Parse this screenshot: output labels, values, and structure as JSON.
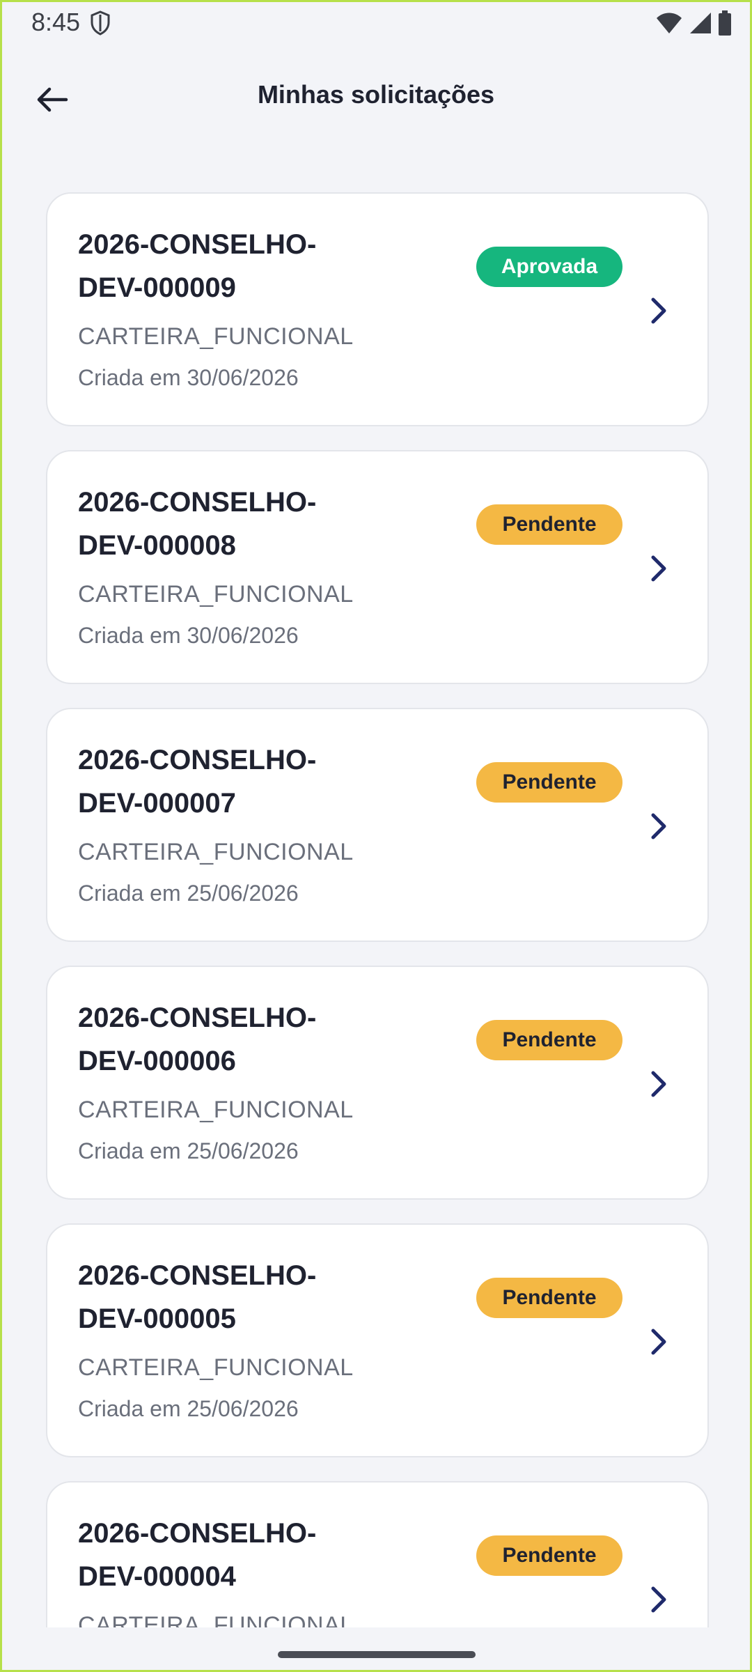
{
  "status_bar": {
    "time": "8:45"
  },
  "app_bar": {
    "title": "Minhas solicitações"
  },
  "requests": [
    {
      "id_line1": "2026-CONSELHO-",
      "id_line2": "DEV-000009",
      "type": "CARTEIRA_FUNCIONAL",
      "created": "Criada em 30/06/2026",
      "status": "Aprovada"
    },
    {
      "id_line1": "2026-CONSELHO-",
      "id_line2": "DEV-000008",
      "type": "CARTEIRA_FUNCIONAL",
      "created": "Criada em 30/06/2026",
      "status": "Pendente"
    },
    {
      "id_line1": "2026-CONSELHO-",
      "id_line2": "DEV-000007",
      "type": "CARTEIRA_FUNCIONAL",
      "created": "Criada em 25/06/2026",
      "status": "Pendente"
    },
    {
      "id_line1": "2026-CONSELHO-",
      "id_line2": "DEV-000006",
      "type": "CARTEIRA_FUNCIONAL",
      "created": "Criada em 25/06/2026",
      "status": "Pendente"
    },
    {
      "id_line1": "2026-CONSELHO-",
      "id_line2": "DEV-000005",
      "type": "CARTEIRA_FUNCIONAL",
      "created": "Criada em 25/06/2026",
      "status": "Pendente"
    },
    {
      "id_line1": "2026-CONSELHO-",
      "id_line2": "DEV-000004",
      "type": "CARTEIRA_FUNCIONAL",
      "created": "",
      "status": "Pendente"
    }
  ],
  "colors": {
    "approved": "#16b67e",
    "pending": "#f4b844",
    "chevron": "#1f2a6b"
  },
  "icons": {
    "back": "arrow-left-icon",
    "chevron": "chevron-right-icon"
  }
}
